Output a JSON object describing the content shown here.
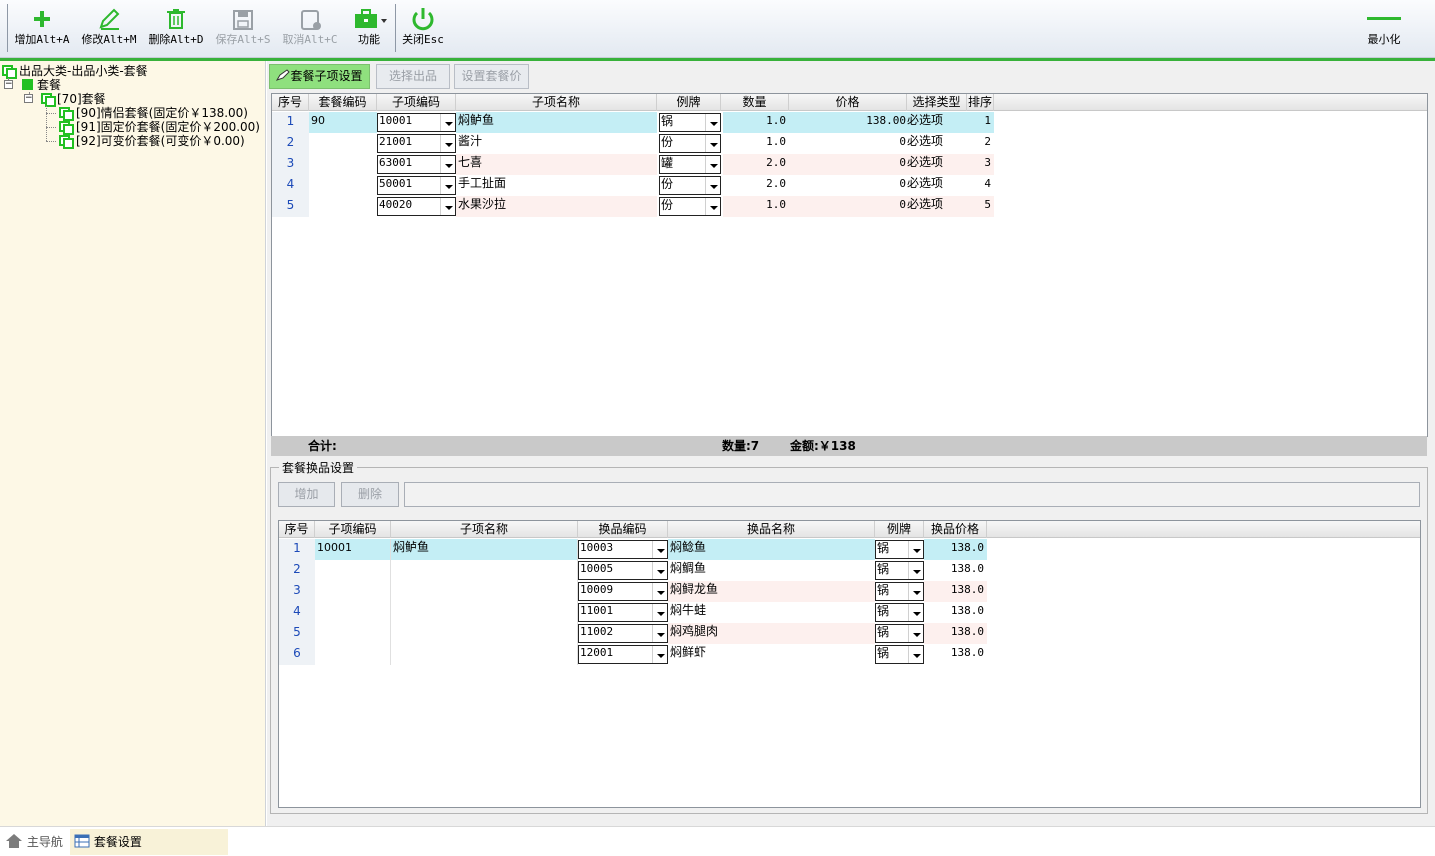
{
  "toolbar": {
    "add": "增加Alt+A",
    "edit": "修改Alt+M",
    "delete": "删除Alt+D",
    "save": "保存Alt+S",
    "cancel": "取消Alt+C",
    "func": "功能",
    "close": "关闭Esc",
    "minimize": "最小化"
  },
  "tree": {
    "root": "出品大类-出品小类-套餐",
    "category": "套餐",
    "subcategory": "[70]套餐",
    "items": [
      "[90]情侣套餐(固定价￥138.00)",
      "[91]固定价套餐(固定价￥200.00)",
      "[92]可变价套餐(可变价￥0.00)"
    ]
  },
  "tabs": {
    "sub_item_settings": "套餐子项设置",
    "select_product": "选择出品",
    "set_price": "设置套餐价"
  },
  "upper_grid": {
    "headers": [
      "序号",
      "套餐编码",
      "子项编码",
      "子项名称",
      "例牌",
      "数量",
      "价格",
      "选择类型",
      "排序"
    ],
    "rows": [
      {
        "idx": "1",
        "set_code": "90",
        "code": "10001",
        "name": "焖鲈鱼",
        "unit": "锅",
        "qty": "1.0",
        "price": "138.00",
        "type": "必选项",
        "sort": "1"
      },
      {
        "idx": "2",
        "set_code": "",
        "code": "21001",
        "name": "酱汁",
        "unit": "份",
        "qty": "1.0",
        "price": "0",
        "type": "必选项",
        "sort": "2"
      },
      {
        "idx": "3",
        "set_code": "",
        "code": "63001",
        "name": "七喜",
        "unit": "罐",
        "qty": "2.0",
        "price": "0",
        "type": "必选项",
        "sort": "3"
      },
      {
        "idx": "4",
        "set_code": "",
        "code": "50001",
        "name": "手工扯面",
        "unit": "份",
        "qty": "2.0",
        "price": "0",
        "type": "必选项",
        "sort": "4"
      },
      {
        "idx": "5",
        "set_code": "",
        "code": "40020",
        "name": "水果沙拉",
        "unit": "份",
        "qty": "1.0",
        "price": "0",
        "type": "必选项",
        "sort": "5"
      }
    ]
  },
  "summary": {
    "label": "合计:",
    "qty": "数量:7",
    "amount": "金额:￥138"
  },
  "swap_section": {
    "title": "套餐换品设置",
    "add": "增加",
    "delete": "删除",
    "headers": [
      "序号",
      "子项编码",
      "子项名称",
      "换品编码",
      "换品名称",
      "例牌",
      "换品价格"
    ],
    "rows": [
      {
        "idx": "1",
        "code": "10001",
        "name": "焖鲈鱼",
        "swap_code": "10003",
        "swap_name": "焖鲶鱼",
        "unit": "锅",
        "price": "138.0"
      },
      {
        "idx": "2",
        "code": "",
        "name": "",
        "swap_code": "10005",
        "swap_name": "焖鲷鱼",
        "unit": "锅",
        "price": "138.0"
      },
      {
        "idx": "3",
        "code": "",
        "name": "",
        "swap_code": "10009",
        "swap_name": "焖鲟龙鱼",
        "unit": "锅",
        "price": "138.0"
      },
      {
        "idx": "4",
        "code": "",
        "name": "",
        "swap_code": "11001",
        "swap_name": "焖牛蛙",
        "unit": "锅",
        "price": "138.0"
      },
      {
        "idx": "5",
        "code": "",
        "name": "",
        "swap_code": "11002",
        "swap_name": "焖鸡腿肉",
        "unit": "锅",
        "price": "138.0"
      },
      {
        "idx": "6",
        "code": "",
        "name": "",
        "swap_code": "12001",
        "swap_name": "焖鲜虾",
        "unit": "锅",
        "price": "138.0"
      }
    ]
  },
  "bottom": {
    "home": "主导航",
    "current": "套餐设置"
  },
  "colors": {
    "accent_green": "#38b13a",
    "selected_row": "#c4eef5",
    "alt_row": "#fdf0ee"
  }
}
